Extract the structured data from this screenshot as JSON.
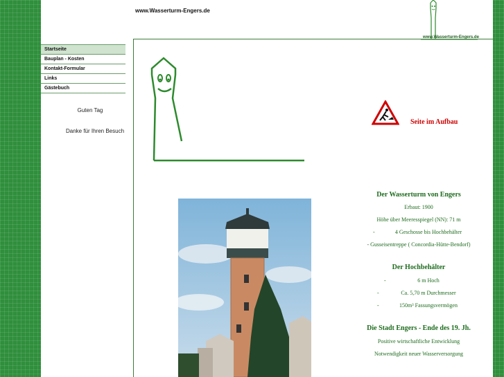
{
  "header": {
    "url_text": "www.Wasserturm-Engers.de",
    "logo_caption": "www.Wasserturm-Engers.de"
  },
  "nav": {
    "items": [
      {
        "label": "Startseite",
        "active": true
      },
      {
        "label": "Bauplan - Kosten"
      },
      {
        "label": "Kontakt-Formular"
      },
      {
        "label": "Links"
      },
      {
        "label": "Gästebuch"
      }
    ]
  },
  "sidebar": {
    "greeting": "Guten Tag",
    "thanks": "Danke für Ihren Besuch"
  },
  "notice": {
    "text": "Seite im Aufbau"
  },
  "info": {
    "tower_title": "Der Wasserturm von Engers",
    "built": "Erbaut: 1900",
    "altitude": "Höhe über Meeresspiegel (NN): 71 m",
    "floors": "4 Geschosse bis Hochbehälter",
    "stairs": "Gusseisentreppe ( Concordia-Hütte-Bendorf)",
    "tank_title": "Der Hochbehälter",
    "tank_height": "6 m Hoch",
    "tank_diameter": "Ca. 5,70 m Durchmesser",
    "tank_capacity": "150m³ Fassungsvermögen",
    "city_title": "Die Stadt Engers - Ende des 19. Jh.",
    "city_growth": "Positive wirtschaftliche Entwicklung",
    "city_need": "Notwendigkeit neuer Wasserversorgung",
    "bullet": "-",
    "bullet_stairs": "- Gusseisentreppe ( Concordia-Hütte-Bendorf)"
  },
  "colors": {
    "accent": "#1d6b1d",
    "notice": "#cc0000",
    "background": "#2f8f3c"
  },
  "icons": {
    "construction": "construction-sign-icon",
    "logo": "tower-logo-icon"
  }
}
